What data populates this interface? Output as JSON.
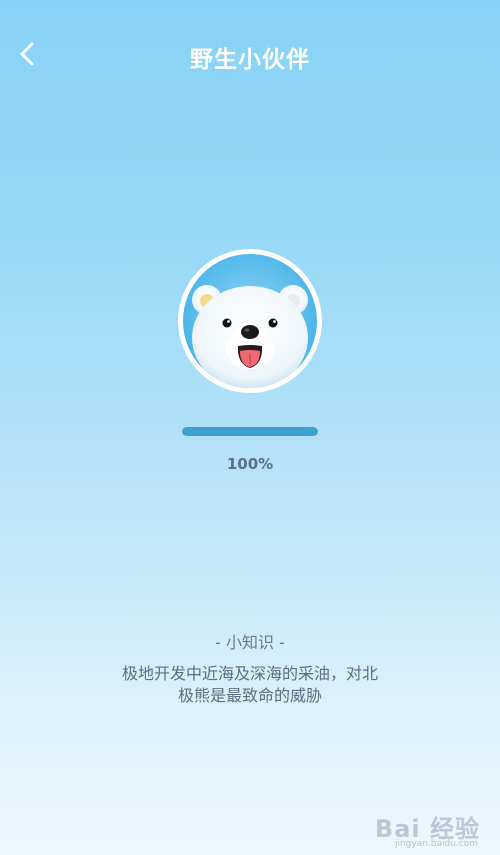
{
  "header": {
    "title": "野生小伙伴",
    "back_icon": "chevron-left-icon"
  },
  "avatar": {
    "icon": "polar-bear-icon"
  },
  "progress": {
    "value": 1.0,
    "label": "100%",
    "fill_color": "#3ea1cf"
  },
  "tip": {
    "heading": "- 小知识 -",
    "line1": "极地开发中近海及深海的采油，对北",
    "line2": "极熊是最致命的威胁"
  },
  "watermark": {
    "text": "Bai 经验",
    "url": "jingyan.baidu.com"
  },
  "colors": {
    "background_top": "#86d2f6",
    "background_bottom": "#ecf8fe",
    "title": "#ffffff",
    "body_text": "#5e6e80"
  }
}
